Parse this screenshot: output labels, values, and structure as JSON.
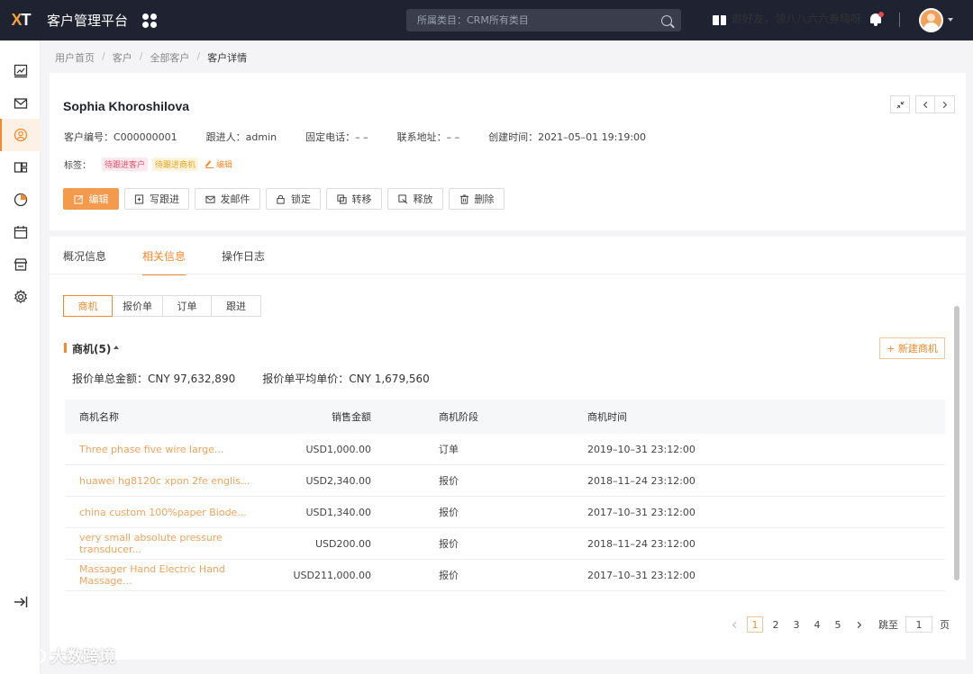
{
  "header": {
    "logo": "XT",
    "app_title": "客户管理平台",
    "search_placeholder": "所属类目：CRM所有类目",
    "invite_text": "邀好友，领八八六六券嗨呀"
  },
  "breadcrumb": [
    "用户首页",
    "客户",
    "全部客户",
    "客户详情"
  ],
  "customer": {
    "name": "Sophia Khoroshilova",
    "info": [
      {
        "label": "客户编号：",
        "value": "C000000001"
      },
      {
        "label": "跟进人：",
        "value": "admin"
      },
      {
        "label": "固定电话：",
        "value": "– –"
      },
      {
        "label": "联系地址：",
        "value": "– –"
      },
      {
        "label": "创建时间：",
        "value": "2021–05–01 19:19:00"
      }
    ],
    "tags_label": "标签：",
    "tags": [
      "待跟进客户",
      "待跟进商机"
    ],
    "tags_edit": "编辑"
  },
  "actions": [
    {
      "label": "编辑",
      "icon": "edit-icon"
    },
    {
      "label": "写跟进",
      "icon": "note-icon"
    },
    {
      "label": "发邮件",
      "icon": "mail-icon"
    },
    {
      "label": "锁定",
      "icon": "lock-icon"
    },
    {
      "label": "转移",
      "icon": "transfer-icon"
    },
    {
      "label": "释放",
      "icon": "release-icon"
    },
    {
      "label": "删除",
      "icon": "trash-icon"
    }
  ],
  "tabs": [
    "概况信息",
    "相关信息",
    "操作日志"
  ],
  "active_tab": 1,
  "subtabs": [
    "商机",
    "报价单",
    "订单",
    "跟进"
  ],
  "active_subtab": 0,
  "section": {
    "title": "商机(5)",
    "new_button": "+ 新建商机",
    "summary_total": "报价单总金额：CNY 97,632,890",
    "summary_avg": "报价单平均单价：CNY 1,679,560"
  },
  "table": {
    "columns": [
      "商机名称",
      "销售金额",
      "商机阶段",
      "商机时间"
    ],
    "rows": [
      {
        "name": "Three phase five wire large...",
        "amount": "USD1,000.00",
        "stage": "订单",
        "time": "2019–10–31  23:12:00"
      },
      {
        "name": "huawei hg8120c xpon 2fe englis...",
        "amount": "USD2,340.00",
        "stage": "报价",
        "time": "2018–11–24  23:12:00"
      },
      {
        "name": "china custom 100%paper Biode...",
        "amount": "USD1,340.00",
        "stage": "报价",
        "time": "2017–10–31  23:12:00"
      },
      {
        "name": "very small absolute pressure transducer...",
        "amount": "USD200.00",
        "stage": "报价",
        "time": "2018–11–24  23:12:00"
      },
      {
        "name": "Massager Hand Electric Hand Massage...",
        "amount": "USD211,000.00",
        "stage": "报价",
        "time": "2017–10–31  23:12:00"
      }
    ]
  },
  "pagination": {
    "pages": [
      "1",
      "2",
      "3",
      "4",
      "5"
    ],
    "current": "1",
    "jump_label": "跳至",
    "jump_value": "1",
    "page_suffix": "页"
  },
  "watermark": "大数跨境",
  "colors": {
    "accent": "#f28a2c",
    "topbar": "#1f2331",
    "primary_button": "#f39a4c"
  }
}
